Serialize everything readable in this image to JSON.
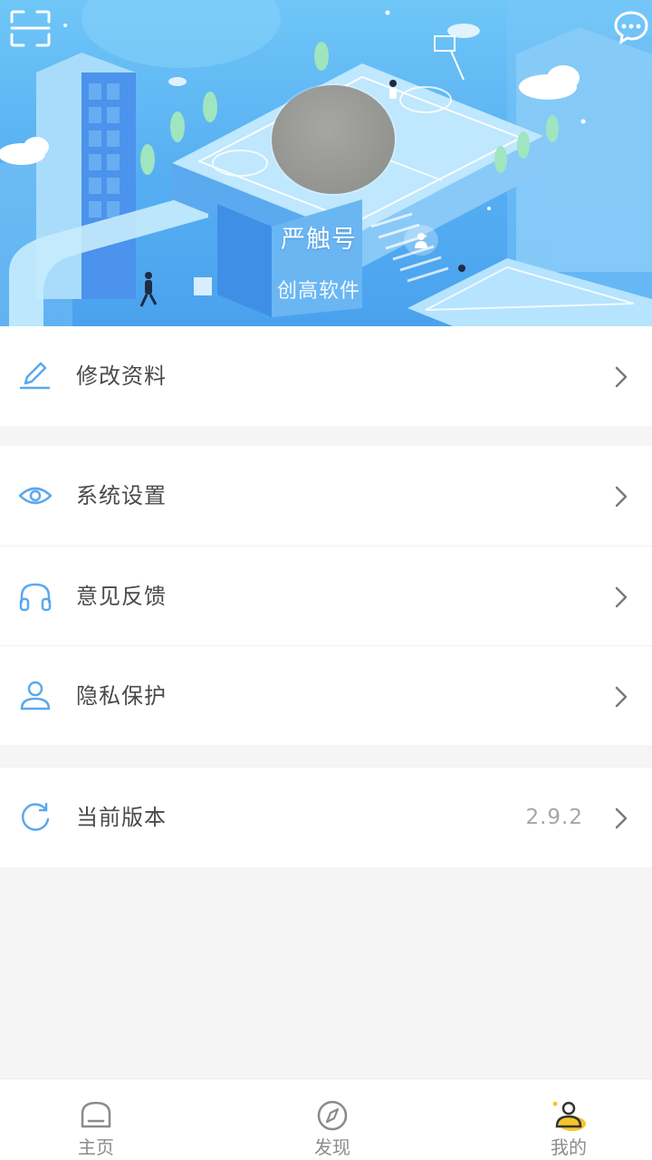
{
  "header": {
    "scan_icon": "scan-icon",
    "message_icon": "message-icon",
    "user_name": "严触号",
    "company": "创高软件",
    "badge_icon": "person-badge-icon"
  },
  "menu": {
    "edit_profile": {
      "label": "修改资料",
      "icon": "pencil-icon"
    },
    "system_settings": {
      "label": "系统设置",
      "icon": "eye-icon"
    },
    "feedback": {
      "label": "意见反馈",
      "icon": "headphones-icon"
    },
    "privacy": {
      "label": "隐私保护",
      "icon": "user-icon"
    },
    "version": {
      "label": "当前版本",
      "value": "2.9.2",
      "icon": "refresh-icon"
    }
  },
  "tabbar": {
    "home": {
      "label": "主页",
      "icon": "home-icon"
    },
    "discover": {
      "label": "发现",
      "icon": "compass-icon"
    },
    "mine": {
      "label": "我的",
      "icon": "profile-icon",
      "active": true
    }
  },
  "colors": {
    "accent_blue": "#4ea6f0",
    "icon_blue": "#5aa8ee",
    "active_yellow": "#f7c52b",
    "page_bg": "#f5f5f5"
  }
}
